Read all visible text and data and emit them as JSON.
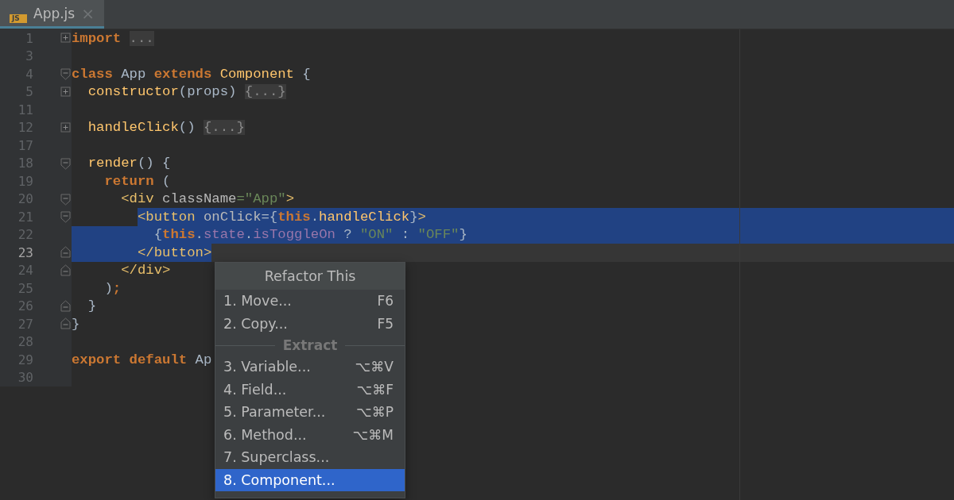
{
  "tabs": [
    {
      "label": "App.js",
      "icon": "JS",
      "selected": true,
      "close": "×"
    }
  ],
  "editor": {
    "lines": [
      {
        "number": "1",
        "collapsed": true,
        "fold_start": false,
        "fold_end": false,
        "selected": false,
        "current": false,
        "groups": [
          [
            {
              "kind": "keyword",
              "text": "import"
            }
          ],
          [
            {
              "kind": "folded",
              "text": "..."
            }
          ]
        ]
      },
      {
        "number": "3",
        "collapsed": false,
        "fold_start": false,
        "fold_end": false,
        "selected": false,
        "current": false
      },
      {
        "number": "4",
        "collapsed": false,
        "fold_start": true,
        "fold_end": false,
        "selected": false,
        "current": false,
        "groups": [
          [
            {
              "kind": "keyword",
              "text": "class"
            }
          ],
          [
            {
              "kind": "plain",
              "text": "App"
            }
          ],
          [
            {
              "kind": "keyword",
              "text": "extends"
            }
          ],
          [
            {
              "kind": "func",
              "text": "Component"
            }
          ],
          [
            {
              "kind": "plain",
              "text": "{"
            }
          ]
        ],
        "children": [
          {
            "number": "5",
            "collapsed": true,
            "fold_start": false,
            "fold_end": false,
            "selected": false,
            "current": false,
            "groups": [
              [
                {
                  "kind": "func",
                  "text": "constructor"
                },
                {
                  "kind": "plain",
                  "text": "(props)"
                }
              ],
              [
                {
                  "kind": "folded",
                  "text": "{...}"
                }
              ]
            ]
          },
          {
            "number": "11",
            "collapsed": false,
            "fold_start": false,
            "fold_end": false,
            "selected": false,
            "current": false
          },
          {
            "number": "12",
            "collapsed": true,
            "fold_start": false,
            "fold_end": false,
            "selected": false,
            "current": false,
            "groups": [
              [
                {
                  "kind": "func",
                  "text": "handleClick"
                },
                {
                  "kind": "plain",
                  "text": "()"
                }
              ],
              [
                {
                  "kind": "folded",
                  "text": "{...}"
                }
              ]
            ]
          },
          {
            "number": "17",
            "collapsed": false,
            "fold_start": false,
            "fold_end": false,
            "selected": false,
            "current": false
          },
          {
            "number": "18",
            "collapsed": false,
            "fold_start": true,
            "fold_end": false,
            "selected": false,
            "current": false,
            "groups": [
              [
                {
                  "kind": "func",
                  "text": "render"
                },
                {
                  "kind": "plain",
                  "text": "()"
                }
              ],
              [
                {
                  "kind": "plain",
                  "text": "{"
                }
              ]
            ],
            "children": [
              {
                "number": "19",
                "collapsed": false,
                "fold_start": false,
                "fold_end": false,
                "selected": false,
                "current": false,
                "groups": [
                  [
                    {
                      "kind": "keyword",
                      "text": "return"
                    }
                  ],
                  [
                    {
                      "kind": "plain",
                      "text": "("
                    }
                  ]
                ],
                "children": [
                  {
                    "number": "20",
                    "collapsed": false,
                    "fold_start": true,
                    "fold_end": false,
                    "selected": false,
                    "current": false,
                    "groups": [
                      [
                        {
                          "kind": "tag",
                          "text": "<div"
                        }
                      ],
                      [
                        {
                          "kind": "attr",
                          "text": "className"
                        },
                        {
                          "kind": "string",
                          "text": "=\"App\""
                        },
                        {
                          "kind": "tag",
                          "text": ">"
                        }
                      ]
                    ],
                    "children": [
                      {
                        "number": "21",
                        "collapsed": false,
                        "fold_start": true,
                        "fold_end": false,
                        "selected": true,
                        "current": false,
                        "groups": [
                          [
                            {
                              "kind": "tag",
                              "text": "<button"
                            }
                          ],
                          [
                            {
                              "kind": "attr",
                              "text": "onClick"
                            },
                            {
                              "kind": "plain",
                              "text": "={"
                            },
                            {
                              "kind": "keyword",
                              "text": "this"
                            },
                            {
                              "kind": "plain",
                              "text": "."
                            },
                            {
                              "kind": "func",
                              "text": "handleClick"
                            },
                            {
                              "kind": "plain",
                              "text": "}"
                            },
                            {
                              "kind": "tag",
                              "text": ">"
                            }
                          ]
                        ],
                        "children": [
                          {
                            "number": "22",
                            "collapsed": false,
                            "fold_start": false,
                            "fold_end": false,
                            "selected": true,
                            "current": false,
                            "groups": [
                              [
                                {
                                  "kind": "plain",
                                  "text": "{"
                                },
                                {
                                  "kind": "keyword",
                                  "text": "this"
                                },
                                {
                                  "kind": "plain",
                                  "text": "."
                                },
                                {
                                  "kind": "prop",
                                  "text": "state"
                                },
                                {
                                  "kind": "plain",
                                  "text": "."
                                },
                                {
                                  "kind": "prop",
                                  "text": "isToggleOn"
                                }
                              ],
                              [
                                {
                                  "kind": "plain",
                                  "text": "?"
                                }
                              ],
                              [
                                {
                                  "kind": "string",
                                  "text": "\"ON\""
                                }
                              ],
                              [
                                {
                                  "kind": "plain",
                                  "text": ":"
                                }
                              ],
                              [
                                {
                                  "kind": "string",
                                  "text": "\"OFF\""
                                },
                                {
                                  "kind": "plain",
                                  "text": "}"
                                }
                              ]
                            ]
                          }
                        ]
                      },
                      {
                        "number": "23",
                        "collapsed": false,
                        "fold_start": false,
                        "fold_end": true,
                        "selected": true,
                        "current": true,
                        "groups": [
                          [
                            {
                              "kind": "tag",
                              "text": "</button>"
                            }
                          ]
                        ]
                      }
                    ]
                  },
                  {
                    "number": "24",
                    "collapsed": false,
                    "fold_start": false,
                    "fold_end": true,
                    "selected": false,
                    "current": false,
                    "groups": [
                      [
                        {
                          "kind": "tag",
                          "text": "</div>"
                        }
                      ]
                    ]
                  }
                ]
              },
              {
                "number": "25",
                "collapsed": false,
                "fold_start": false,
                "fold_end": false,
                "selected": false,
                "current": false,
                "groups": [
                  [
                    {
                      "kind": "plain",
                      "text": ")"
                    },
                    {
                      "kind": "keyword",
                      "text": ";"
                    }
                  ]
                ]
              }
            ]
          },
          {
            "number": "26",
            "collapsed": false,
            "fold_start": false,
            "fold_end": true,
            "selected": false,
            "current": false,
            "groups": [
              [
                {
                  "kind": "plain",
                  "text": "}"
                }
              ]
            ]
          }
        ]
      },
      {
        "number": "27",
        "collapsed": false,
        "fold_start": false,
        "fold_end": true,
        "selected": false,
        "current": false,
        "groups": [
          [
            {
              "kind": "plain",
              "text": "}"
            }
          ]
        ]
      },
      {
        "number": "28",
        "collapsed": false,
        "fold_start": false,
        "fold_end": false,
        "selected": false,
        "current": false
      },
      {
        "number": "29",
        "collapsed": false,
        "fold_start": false,
        "fold_end": false,
        "selected": false,
        "current": false,
        "groups": [
          [
            {
              "kind": "keyword",
              "text": "export"
            }
          ],
          [
            {
              "kind": "keyword",
              "text": "default"
            }
          ],
          [
            {
              "kind": "plain",
              "text": "Ap"
            }
          ]
        ]
      },
      {
        "number": "30",
        "collapsed": false,
        "fold_start": false,
        "fold_end": false,
        "selected": false,
        "current": false
      }
    ]
  },
  "popup": {
    "title": "Refactor This",
    "entries": [
      {
        "kind": "item",
        "label": "1. Move...",
        "shortcut": "F6",
        "selected": false
      },
      {
        "kind": "item",
        "label": "2. Copy...",
        "shortcut": "F5",
        "selected": false
      },
      {
        "kind": "separator",
        "label": "Extract"
      },
      {
        "kind": "item",
        "label": "3. Variable...",
        "shortcut": "⌥⌘V",
        "selected": false
      },
      {
        "kind": "item",
        "label": "4. Field...",
        "shortcut": "⌥⌘F",
        "selected": false
      },
      {
        "kind": "item",
        "label": "5. Parameter...",
        "shortcut": "⌥⌘P",
        "selected": false
      },
      {
        "kind": "item",
        "label": "6. Method...",
        "shortcut": "⌥⌘M",
        "selected": false
      },
      {
        "kind": "item",
        "label": "7. Superclass...",
        "selected": false
      },
      {
        "kind": "item",
        "label": "8. Component...",
        "selected": true
      }
    ]
  }
}
